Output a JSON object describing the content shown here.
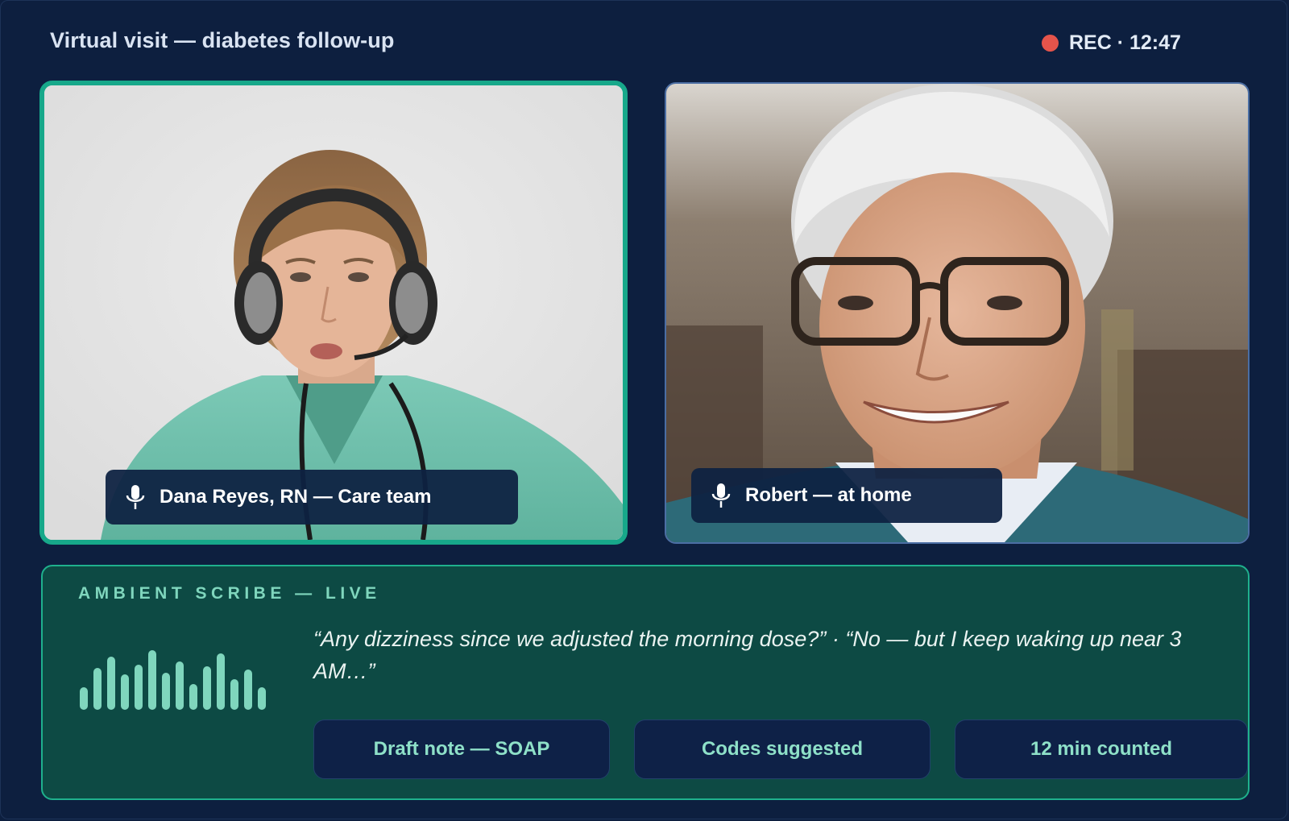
{
  "header": {
    "title": "Virtual visit — diabetes follow-up",
    "rec_label": "REC · 12:47"
  },
  "participants": [
    {
      "label": "Dana Reyes, RN — Care team",
      "icon": "mic-icon",
      "active_speaker": true
    },
    {
      "label": "Robert — at home",
      "icon": "mic-icon",
      "active_speaker": false
    }
  ],
  "scribe": {
    "label": "AMBIENT SCRIBE — LIVE",
    "transcript": "“Any dizziness since we adjusted the morning dose?”  ·  “No — but I keep waking up near 3 AM…”",
    "chips": [
      {
        "label": "Draft note — SOAP"
      },
      {
        "label": "Codes suggested"
      },
      {
        "label": "12 min counted"
      }
    ]
  },
  "colors": {
    "background": "#0d1f3f",
    "active_border": "#17a88a",
    "rec_dot": "#e5544b",
    "scribe_panel": "#0d4a44",
    "accent_text": "#8ee0c8"
  }
}
